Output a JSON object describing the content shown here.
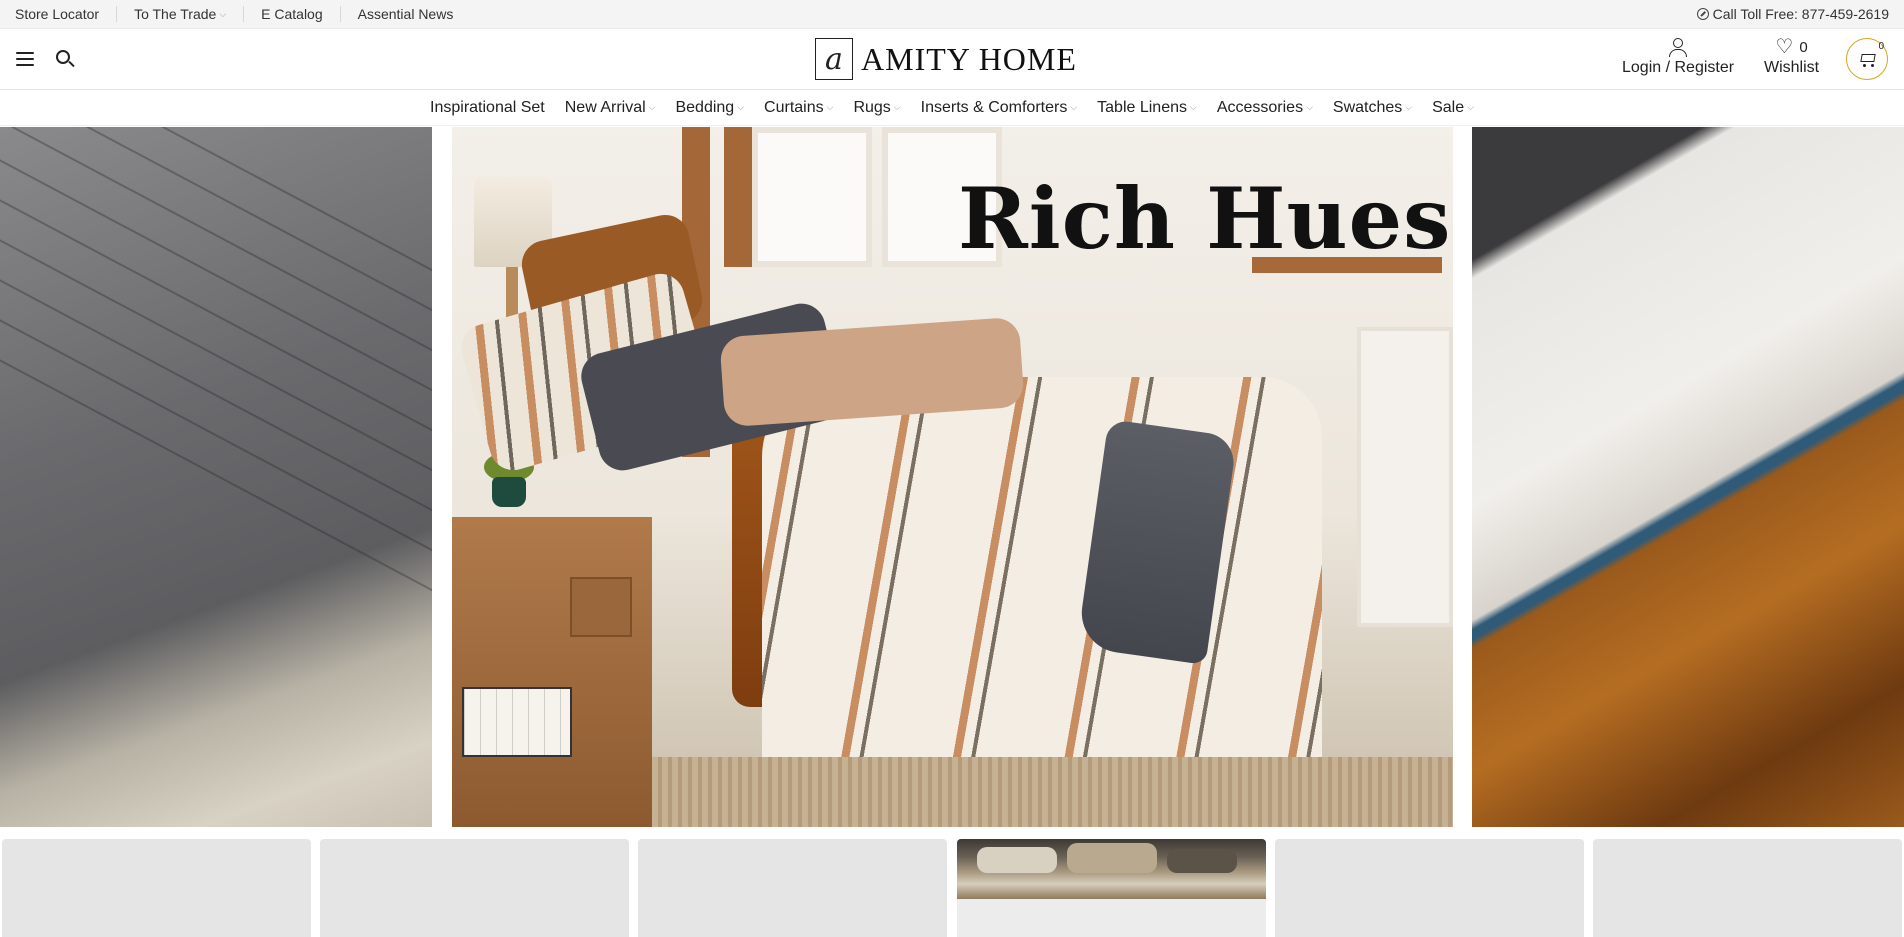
{
  "utility_bar": {
    "links": [
      {
        "label": "Store Locator",
        "dropdown": false
      },
      {
        "label": "To The Trade",
        "dropdown": true
      },
      {
        "label": "E Catalog",
        "dropdown": false
      },
      {
        "label": "Assential News",
        "dropdown": false
      }
    ],
    "toll_free": "Call Toll Free: 877-459-2619"
  },
  "header": {
    "logo_mark": "a",
    "logo_text": "AMITY HOME",
    "account_label": "Login / Register",
    "wishlist_label": "Wishlist",
    "wishlist_count": "0",
    "cart_count": "0",
    "accent_color": "#d9a51b"
  },
  "nav": {
    "items": [
      {
        "label": "Inspirational Set",
        "dropdown": false
      },
      {
        "label": "New Arrival",
        "dropdown": true
      },
      {
        "label": "Bedding",
        "dropdown": true
      },
      {
        "label": "Curtains",
        "dropdown": true
      },
      {
        "label": "Rugs",
        "dropdown": true
      },
      {
        "label": "Inserts & Comforters",
        "dropdown": true
      },
      {
        "label": "Table Linens",
        "dropdown": true
      },
      {
        "label": "Accessories",
        "dropdown": true
      },
      {
        "label": "Swatches",
        "dropdown": true
      },
      {
        "label": "Sale",
        "dropdown": true
      }
    ]
  },
  "hero": {
    "headline": "Rich Hues"
  },
  "icons": {
    "menu": "menu-icon",
    "search": "search-icon",
    "user": "user-icon",
    "wishlist": "heart-icon",
    "cart": "cart-icon",
    "phone": "phone-icon"
  }
}
